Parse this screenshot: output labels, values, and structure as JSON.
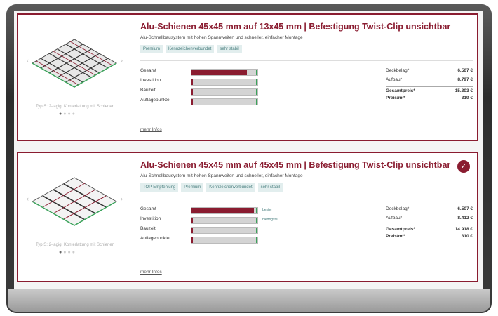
{
  "products": [
    {
      "title": "Alu-Schienen 45x45 mm auf 13x45 mm | Befestigung Twist-Clip unsichtbar",
      "subtitle": "Alu-Schnellbausystem mit hohen Spannweiten und schneller, einfacher Montage",
      "tags": [
        "Premium",
        "Kennzeichenverbundet",
        "sehr stabil"
      ],
      "caption": "Typ S: 2-lagig, Konterlattung mit Schienen",
      "metrics": [
        {
          "label": "Gesamt",
          "value": 0.84,
          "note": ""
        },
        {
          "label": "Investition",
          "value": 0.02,
          "note": ""
        },
        {
          "label": "Bauzeit",
          "value": 0.02,
          "note": ""
        },
        {
          "label": "Auflagepunkte",
          "value": 0.02,
          "note": ""
        }
      ],
      "more": "mehr Infos",
      "prices": [
        {
          "label": "Deckbelag*",
          "value": "6.507 €"
        },
        {
          "label": "Aufbau*",
          "value": "8.797 €"
        },
        {
          "label": "Gesamtpreis*",
          "value": "15.303 €"
        },
        {
          "label": "Preis/m²*",
          "value": "319 €"
        }
      ],
      "selected": false
    },
    {
      "title": "Alu-Schienen 45x45 mm auf 45x45 mm | Befestigung Twist-Clip unsichtbar",
      "subtitle": "Alu-Schnellbausystem mit hohen Spannweiten und schneller, einfacher Montage",
      "tags": [
        "TOP-Empfehlung",
        "Premium",
        "Kennzeichenverbundet",
        "sehr stabil"
      ],
      "caption": "Typ S: 2-lagig, Konterlattung mit Schienen",
      "metrics": [
        {
          "label": "Gesamt",
          "value": 0.95,
          "note": "bester"
        },
        {
          "label": "Investition",
          "value": 0.02,
          "note": "niedrigste"
        },
        {
          "label": "Bauzeit",
          "value": 0.02,
          "note": ""
        },
        {
          "label": "Auflagepunkte",
          "value": 0.02,
          "note": ""
        }
      ],
      "more": "mehr Infos",
      "prices": [
        {
          "label": "Deckbelag*",
          "value": "6.507 €"
        },
        {
          "label": "Aufbau*",
          "value": "8.412 €"
        },
        {
          "label": "Gesamtpreis*",
          "value": "14.918 €"
        },
        {
          "label": "Preis/m²*",
          "value": "310 €"
        }
      ],
      "selected": true
    }
  ],
  "colors": {
    "accent": "#8a1c30",
    "tag_text": "#4a7f7f",
    "tag_bg": "#e2eeee",
    "bar_end": "#3aa35a"
  },
  "icons": {
    "selected": "check-icon",
    "prev": "chevron-left-icon",
    "next": "chevron-right-icon"
  }
}
